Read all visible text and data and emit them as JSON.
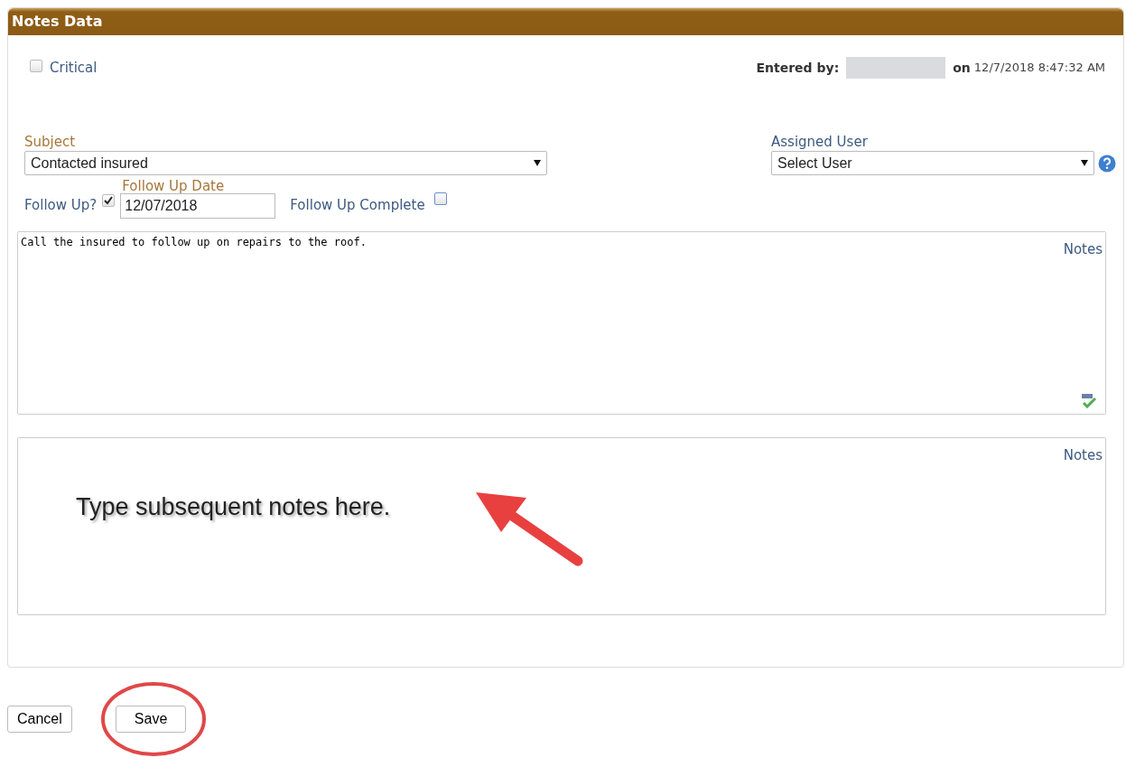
{
  "panel": {
    "title": "Notes Data"
  },
  "critical": {
    "label": "Critical",
    "checked": false
  },
  "entered": {
    "label": "Entered by:",
    "connector": "on",
    "timestamp": "12/7/2018 8:47:32 AM"
  },
  "subject": {
    "label": "Subject",
    "value": "Contacted insured"
  },
  "assigned_user": {
    "label": "Assigned User",
    "value": "Select User"
  },
  "follow_up": {
    "label": "Follow Up?",
    "checked": true,
    "date_label": "Follow Up Date",
    "date": "12/07/2018"
  },
  "follow_up_complete": {
    "label": "Follow Up Complete",
    "checked": false
  },
  "notes": [
    {
      "label": "Notes",
      "value": "Call the insured to follow up on repairs to the roof.",
      "spellcheck": true
    },
    {
      "label": "Notes",
      "annotation": "Type subsequent notes here."
    }
  ],
  "buttons": [
    {
      "label": "Cancel",
      "circled": false
    },
    {
      "label": "Save",
      "circled": true
    }
  ]
}
